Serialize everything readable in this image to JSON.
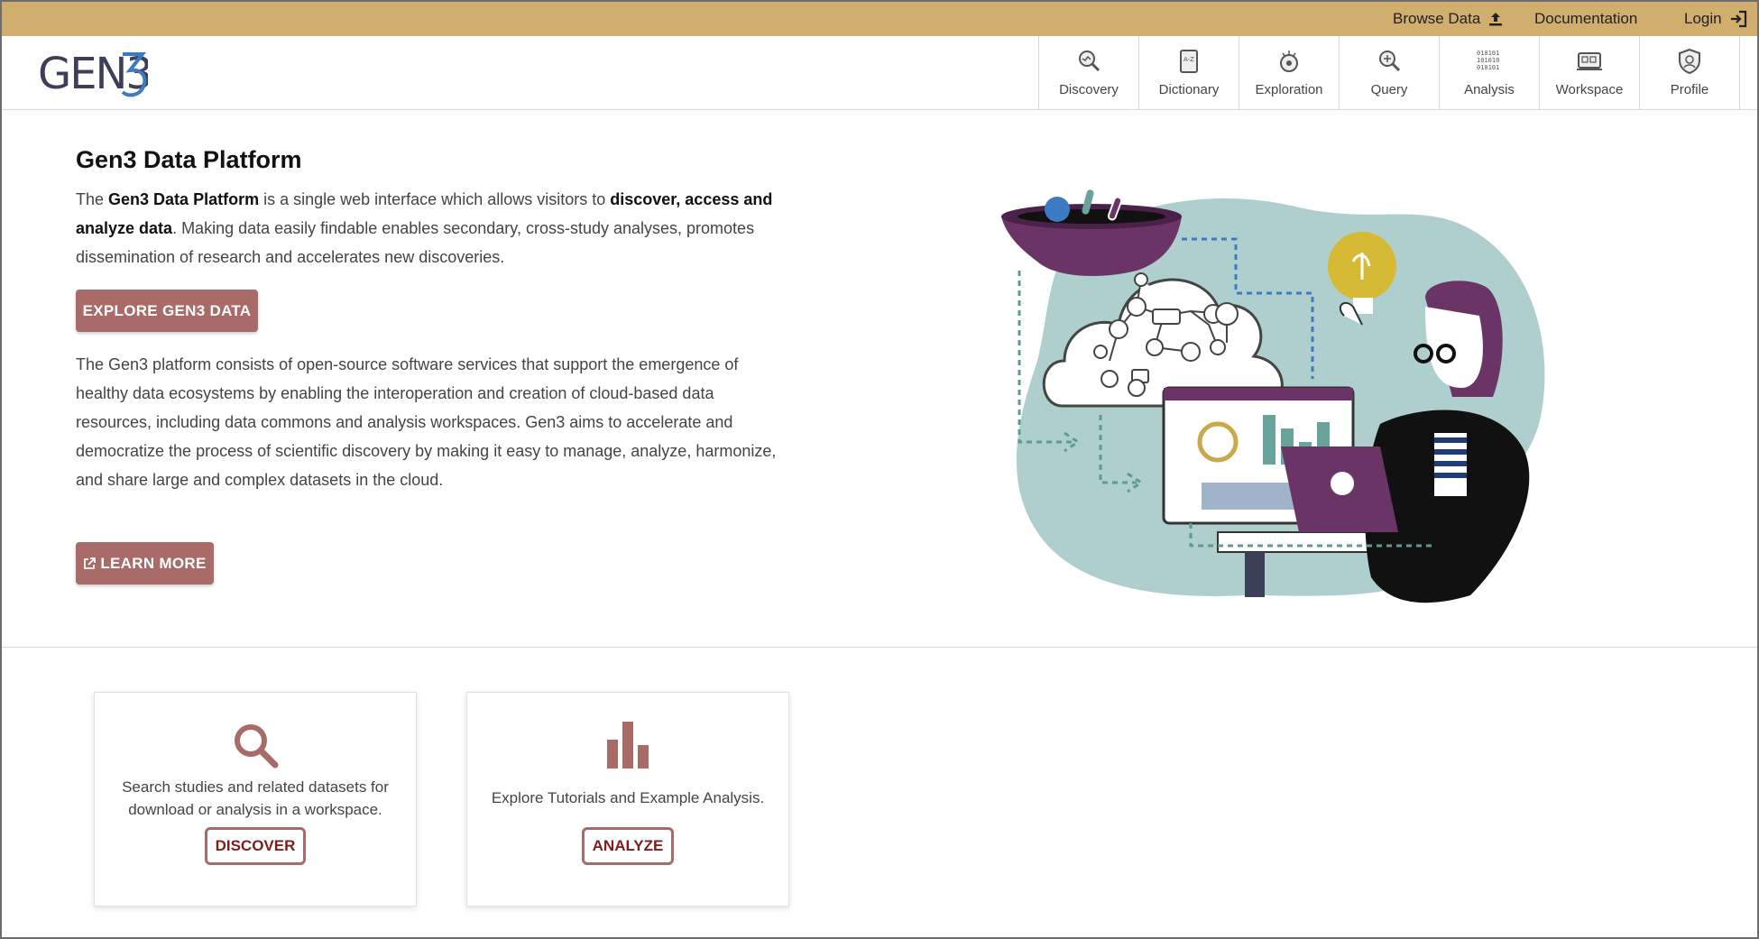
{
  "topbar": {
    "links": [
      {
        "label": "Browse Data",
        "icon": "upload-icon"
      },
      {
        "label": "Documentation"
      },
      {
        "label": "Login",
        "icon": "login-icon"
      }
    ]
  },
  "logo": {
    "text": "GEN3"
  },
  "nav": {
    "items": [
      {
        "label": "Discovery",
        "icon": "discovery-icon"
      },
      {
        "label": "Dictionary",
        "icon": "dictionary-icon"
      },
      {
        "label": "Exploration",
        "icon": "exploration-icon"
      },
      {
        "label": "Query",
        "icon": "query-icon"
      },
      {
        "label": "Analysis",
        "icon": "analysis-icon"
      },
      {
        "label": "Workspace",
        "icon": "workspace-icon"
      },
      {
        "label": "Profile",
        "icon": "profile-icon"
      }
    ]
  },
  "hero": {
    "title": "Gen3 Data Platform",
    "intro": {
      "t1": "The ",
      "b1": "Gen3 Data Platform",
      "t2": " is a single web interface which allows visitors to ",
      "b2": "discover, access and analyze data",
      "t3": ". Making data easily findable enables secondary, cross-study analyses, promotes dissemination of research and accelerates new discoveries."
    },
    "explore_button": "EXPLORE GEN3 DATA",
    "body": "The Gen3 platform consists of open-source software services that support the emergence of healthy data ecosystems by enabling the interoperation and creation of cloud-based data resources, including data commons and analysis workspaces. Gen3 aims to accelerate and democratize the process of scientific discovery by making it easy to manage, analyze, harmonize, and share large and complex datasets in the cloud.",
    "learn_more_button": "LEARN MORE"
  },
  "cards": [
    {
      "icon": "search-icon",
      "text": "Search studies and related datasets for download or analysis in a workspace.",
      "button": "DISCOVER"
    },
    {
      "icon": "bar-chart-icon",
      "text": "Explore Tutorials and Example Analysis.",
      "button": "ANALYZE"
    }
  ],
  "colors": {
    "topbar": "#d1ad6e",
    "accent": "#a96b68",
    "accent_dark": "#7a1e1e",
    "purple": "#6b3467",
    "teal": "#aecfcd"
  }
}
